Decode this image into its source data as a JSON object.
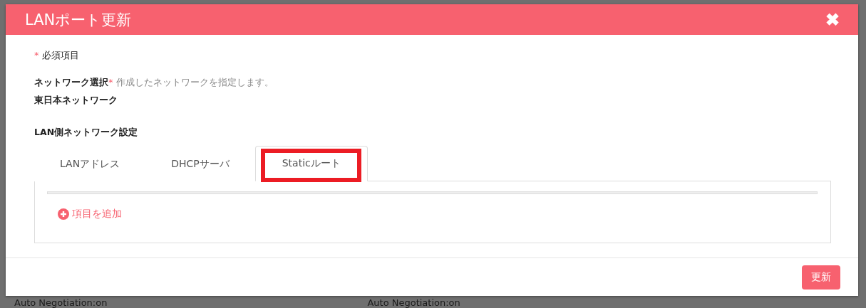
{
  "dialog": {
    "title": "LANポート更新",
    "close_icon": "✖"
  },
  "required_note": {
    "mark": "*",
    "text": "必須項目"
  },
  "network": {
    "label": "ネットワーク選択",
    "mark": "*",
    "hint": "作成したネットワークを指定します。",
    "value": "東日本ネットワーク"
  },
  "section_title": "LAN側ネットワーク設定",
  "tabs": [
    {
      "label": "LANアドレス",
      "selected": false,
      "highlighted": false
    },
    {
      "label": "DHCPサーバ",
      "selected": false,
      "highlighted": false
    },
    {
      "label": "Staticルート",
      "selected": true,
      "highlighted": true
    }
  ],
  "add_item": "項目を追加",
  "submit_button": "更新",
  "background": {
    "texts": [
      "Auto Negotiation:on",
      "Auto Negotiation:on"
    ]
  }
}
